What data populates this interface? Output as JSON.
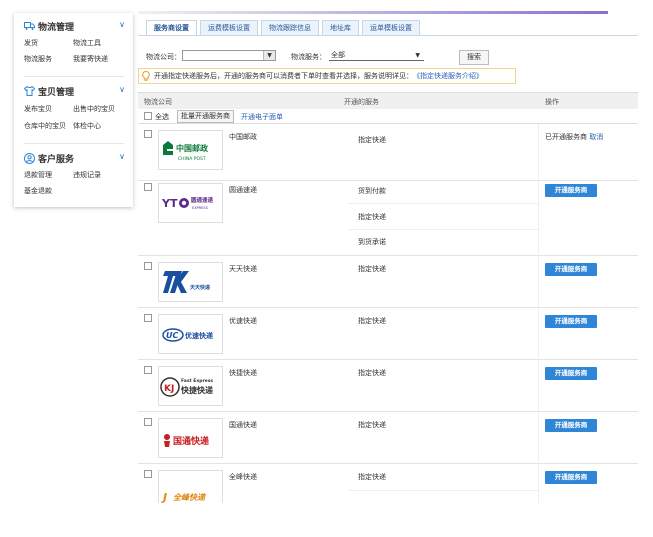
{
  "sidebar": {
    "groups": [
      {
        "title": "物流管理",
        "links": [
          "发货",
          "物流工具",
          "物流服务",
          "我要寄快递"
        ]
      },
      {
        "title": "宝贝管理",
        "links": [
          "发布宝贝",
          "出售中的宝贝",
          "仓库中的宝贝",
          "体检中心"
        ]
      },
      {
        "title": "客户服务",
        "links": [
          "退款管理",
          "违规记录",
          "基金退款"
        ]
      }
    ]
  },
  "tabs": [
    "服务商设置",
    "运费模板设置",
    "物流跟踪信息",
    "地址库",
    "运单模板设置"
  ],
  "filters": {
    "company_label": "物流公司：",
    "company_value": "",
    "service_label": "物流服务：",
    "service_value": "全部",
    "search_label": "搜索"
  },
  "notice": {
    "text": "开通指定快递服务后，开通的服务商可以消费者下单时查看并选择，服务说明详见：",
    "link": "《指定快递服务介绍》"
  },
  "table": {
    "headers": [
      "物流公司",
      "开通的服务",
      "操作"
    ],
    "select_all": "全选",
    "batch_label": "批量开通服务商",
    "eface_label": "开通电子面单",
    "open_label": "开通服务商",
    "rows": [
      {
        "name": "中国邮政",
        "logo_text": "中国邮政",
        "logo_sub": "CHINA POST",
        "services": [
          "指定快递"
        ],
        "status": "已开通服务商",
        "cancel": "取消"
      },
      {
        "name": "圆通速递",
        "logo_text": "圆通速递",
        "logo_sub": "EXPRESS",
        "services": [
          "货到付款",
          "指定快递",
          "到货承诺"
        ]
      },
      {
        "name": "天天快递",
        "logo_text": "天天快递",
        "logo_sub": "",
        "services": [
          "指定快递"
        ]
      },
      {
        "name": "优速快递",
        "logo_text": "优速快递",
        "logo_sub": "",
        "services": [
          "指定快递"
        ]
      },
      {
        "name": "快捷快递",
        "logo_text": "快捷快递",
        "logo_sub": "Fast Express",
        "services": [
          "指定快递"
        ]
      },
      {
        "name": "国通快递",
        "logo_text": "国通快递",
        "logo_sub": "",
        "services": [
          "指定快递"
        ]
      },
      {
        "name": "全峰快递",
        "logo_text": "全峰快递",
        "logo_sub": "",
        "services": [
          "指定快递"
        ]
      }
    ]
  },
  "colors": {
    "primary": "#2f86d6",
    "link": "#2a63b8",
    "tab_bg": "#eaf2fb"
  }
}
